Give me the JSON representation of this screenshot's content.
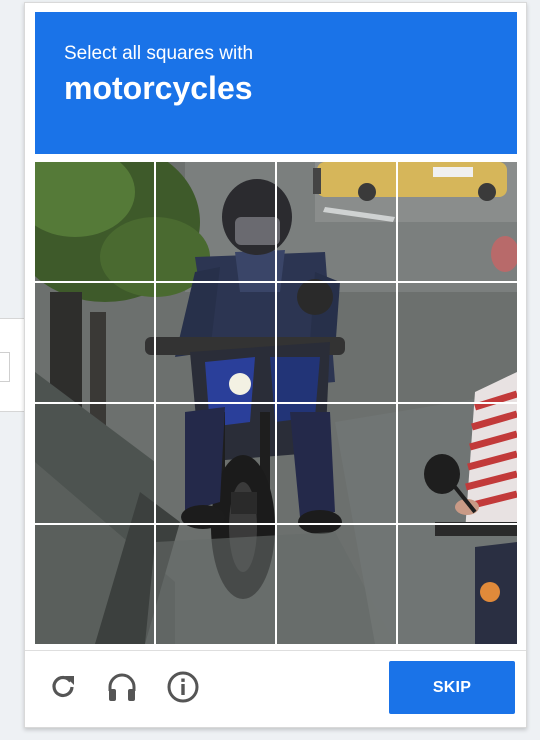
{
  "header": {
    "instruction": "Select all squares with",
    "target": "motorcycles",
    "background": "#1a73e8"
  },
  "grid": {
    "rows": 4,
    "cols": 4,
    "image_description_icon": "photo-grid"
  },
  "footer": {
    "reload_icon": "reload-icon",
    "audio_icon": "headphones-icon",
    "info_icon": "info-icon",
    "skip_label": "SKIP",
    "icon_color": "#555555"
  }
}
